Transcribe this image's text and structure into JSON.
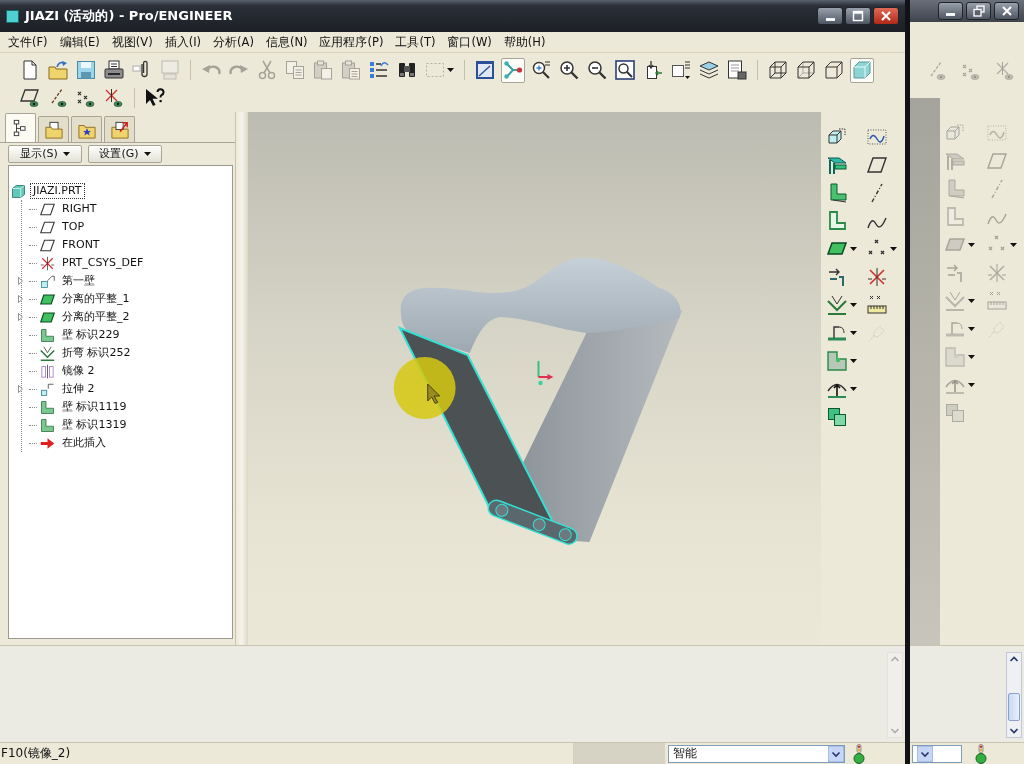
{
  "window": {
    "title": "JIAZI (活动的) - Pro/ENGINEER",
    "controls": [
      {
        "kind": "minimize"
      },
      {
        "kind": "maximize"
      },
      {
        "kind": "close"
      }
    ]
  },
  "menu": [
    "文件(F)",
    "编辑(E)",
    "视图(V)",
    "插入(I)",
    "分析(A)",
    "信息(N)",
    "应用程序(P)",
    "工具(T)",
    "窗口(W)",
    "帮助(H)"
  ],
  "toolbar": [
    [
      [
        {
          "kind": "new",
          "disabled": false,
          "pressed": false,
          "dropdown": false
        },
        {
          "kind": "open",
          "disabled": false,
          "pressed": false,
          "dropdown": false
        },
        {
          "kind": "save",
          "disabled": false,
          "pressed": false,
          "dropdown": false
        },
        {
          "kind": "print",
          "disabled": false,
          "pressed": false,
          "dropdown": false
        },
        {
          "kind": "attach",
          "disabled": false,
          "pressed": false,
          "dropdown": false
        },
        {
          "kind": "monitor",
          "disabled": true,
          "pressed": false,
          "dropdown": false
        }
      ],
      [
        {
          "kind": "undo",
          "disabled": true,
          "pressed": false,
          "dropdown": false
        },
        {
          "kind": "redo",
          "disabled": true,
          "pressed": false,
          "dropdown": false
        },
        {
          "kind": "cut",
          "disabled": true,
          "pressed": false,
          "dropdown": false
        },
        {
          "kind": "copy",
          "disabled": true,
          "pressed": false,
          "dropdown": false
        },
        {
          "kind": "paste",
          "disabled": true,
          "pressed": false,
          "dropdown": false
        },
        {
          "kind": "paste-special",
          "disabled": true,
          "pressed": false,
          "dropdown": false
        },
        {
          "kind": "regenerate",
          "disabled": false,
          "pressed": false,
          "dropdown": false
        },
        {
          "kind": "find",
          "disabled": false,
          "pressed": false,
          "dropdown": false
        },
        {
          "kind": "select-box",
          "disabled": true,
          "pressed": false,
          "dropdown": true
        }
      ],
      [
        {
          "kind": "repaint",
          "disabled": false,
          "pressed": false,
          "dropdown": false
        },
        {
          "kind": "spin-center",
          "disabled": false,
          "pressed": true,
          "dropdown": false
        },
        {
          "kind": "orient",
          "disabled": false,
          "pressed": false,
          "dropdown": false
        },
        {
          "kind": "zoom-in",
          "disabled": false,
          "pressed": false,
          "dropdown": false
        },
        {
          "kind": "zoom-out",
          "disabled": false,
          "pressed": false,
          "dropdown": false
        },
        {
          "kind": "refit",
          "disabled": false,
          "pressed": false,
          "dropdown": false
        },
        {
          "kind": "reorient",
          "disabled": false,
          "pressed": false,
          "dropdown": false
        },
        {
          "kind": "saved-views",
          "disabled": false,
          "pressed": false,
          "dropdown": false
        },
        {
          "kind": "layers",
          "disabled": false,
          "pressed": false,
          "dropdown": false
        },
        {
          "kind": "view-manager",
          "disabled": false,
          "pressed": false,
          "dropdown": false
        }
      ],
      [
        {
          "kind": "wireframe",
          "disabled": false,
          "pressed": false,
          "dropdown": false
        },
        {
          "kind": "hidden-line",
          "disabled": false,
          "pressed": false,
          "dropdown": false
        },
        {
          "kind": "no-hidden",
          "disabled": false,
          "pressed": false,
          "dropdown": false
        },
        {
          "kind": "shading",
          "disabled": false,
          "pressed": true,
          "dropdown": false
        }
      ]
    ],
    [
      [
        {
          "kind": "datum-planes",
          "disabled": false,
          "pressed": false,
          "dropdown": false
        },
        {
          "kind": "datum-axes",
          "disabled": false,
          "pressed": false,
          "dropdown": false
        },
        {
          "kind": "datum-points",
          "disabled": false,
          "pressed": false,
          "dropdown": false
        },
        {
          "kind": "datum-csys",
          "disabled": false,
          "pressed": false,
          "dropdown": false
        }
      ],
      [
        {
          "kind": "help",
          "disabled": false,
          "pressed": false,
          "dropdown": false
        }
      ]
    ]
  ],
  "panel_tabs": [
    {
      "kind": "model-tree",
      "selected": true
    },
    {
      "kind": "folder-browser",
      "selected": false
    },
    {
      "kind": "favorites",
      "selected": false
    },
    {
      "kind": "connections",
      "selected": false
    }
  ],
  "panel_menus": [
    "显示(S)",
    "设置(G)"
  ],
  "model_tree": {
    "label": "JIAZI.PRT",
    "kind": "part",
    "focused": true,
    "children": [
      {
        "label": "RIGHT",
        "kind": "plane",
        "expandable": false
      },
      {
        "label": "TOP",
        "kind": "plane",
        "expandable": false
      },
      {
        "label": "FRONT",
        "kind": "plane",
        "expandable": false
      },
      {
        "label": "PRT_CSYS_DEF",
        "kind": "csys",
        "expandable": false
      },
      {
        "label": "第一壁",
        "kind": "first-wall",
        "expandable": true
      },
      {
        "label": "分离的平整_1",
        "kind": "flat",
        "expandable": true
      },
      {
        "label": "分离的平整_2",
        "kind": "flat",
        "expandable": true
      },
      {
        "label": "壁 标识229",
        "kind": "wall",
        "expandable": false
      },
      {
        "label": "折弯 标识252",
        "kind": "bend",
        "expandable": false
      },
      {
        "label": "镜像 2",
        "kind": "mirror",
        "expandable": false
      },
      {
        "label": "拉伸 2",
        "kind": "extrude",
        "expandable": true
      },
      {
        "label": "壁 标识1119",
        "kind": "wall",
        "expandable": false
      },
      {
        "label": "壁 标识1319",
        "kind": "wall",
        "expandable": false
      },
      {
        "label": "在此插入",
        "kind": "insert",
        "expandable": false
      }
    ]
  },
  "right_toolbar": {
    "column_1": [
      {
        "kind": "convert",
        "disabled": false,
        "dropdown": false
      },
      {
        "kind": "flat-wall",
        "disabled": false,
        "dropdown": false
      },
      {
        "kind": "flange-wall",
        "disabled": false,
        "dropdown": false
      },
      {
        "kind": "extend-wall",
        "disabled": false,
        "dropdown": false
      },
      {
        "kind": "unattached-wall",
        "disabled": false,
        "dropdown": true
      },
      {
        "kind": "rip",
        "disabled": false,
        "dropdown": false
      },
      {
        "kind": "bend",
        "disabled": false,
        "dropdown": true
      },
      {
        "kind": "unbend",
        "disabled": false,
        "dropdown": true
      },
      {
        "kind": "sm-cut",
        "disabled": false,
        "dropdown": true
      },
      {
        "kind": "form",
        "disabled": false,
        "dropdown": true
      },
      {
        "kind": "flat-pattern",
        "disabled": false,
        "dropdown": false
      }
    ],
    "column_2": [
      {
        "kind": "sketch",
        "disabled": false,
        "dropdown": false
      },
      {
        "kind": "plane",
        "disabled": false,
        "dropdown": false
      },
      {
        "kind": "axis",
        "disabled": false,
        "dropdown": false
      },
      {
        "kind": "curve",
        "disabled": false,
        "dropdown": false
      },
      {
        "kind": "points",
        "disabled": false,
        "dropdown": true
      },
      {
        "kind": "csys",
        "disabled": false,
        "dropdown": false
      },
      {
        "kind": "analysis",
        "disabled": false,
        "dropdown": false
      },
      {
        "kind": "link",
        "disabled": true,
        "dropdown": false
      }
    ]
  },
  "status_bar": {
    "message": "F10(镜像_2)",
    "filter": "智能"
  },
  "background_window": {
    "active": false,
    "controls": [
      {
        "kind": "minimize"
      },
      {
        "kind": "restore"
      },
      {
        "kind": "close"
      }
    ],
    "toolbar": [
      {
        "kind": "datum-axes"
      },
      {
        "kind": "datum-points"
      },
      {
        "kind": "datum-csys"
      }
    ]
  }
}
